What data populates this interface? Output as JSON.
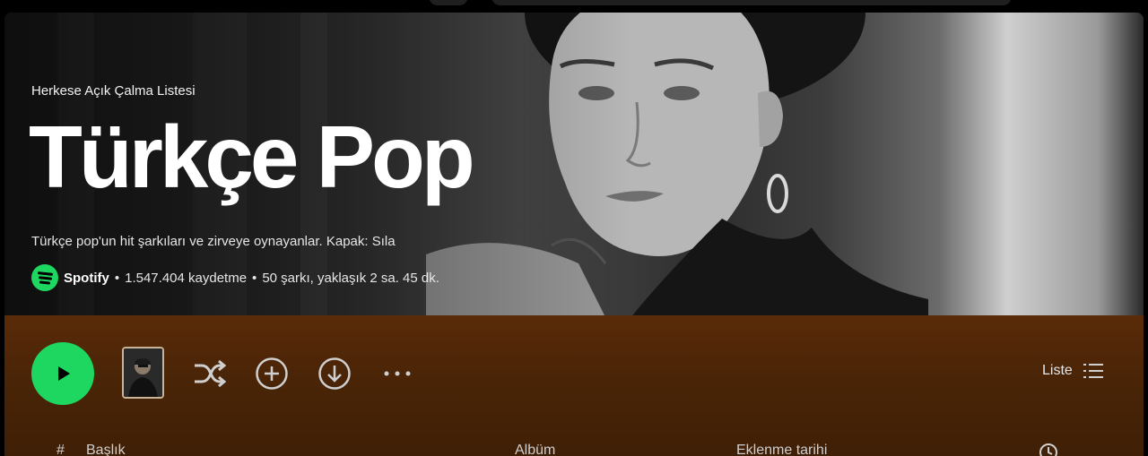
{
  "playlist": {
    "type_label": "Herkese Açık Çalma Listesi",
    "title": "Türkçe Pop",
    "description": "Türkçe pop'un hit şarkıları ve zirveye oynayanlar. Kapak: Sıla",
    "owner": "Spotify",
    "saves": "1.547.404 kaydetme",
    "summary": "50 şarkı, yaklaşık 2 sa. 45 dk.",
    "separator": "•"
  },
  "actions": {
    "view_mode_label": "Liste"
  },
  "table_header": {
    "number": "#",
    "title": "Başlık",
    "album": "Albüm",
    "date_added": "Eklenme tarihi"
  },
  "icons": {
    "play": "play-icon",
    "shuffle": "shuffle-icon",
    "add": "add-circle-icon",
    "download": "download-icon",
    "more": "more-icon",
    "list": "list-icon",
    "clock": "clock-icon"
  },
  "colors": {
    "accent": "#1ed760",
    "action_bar": "#4b2507",
    "text_muted": "#cfcfcf"
  }
}
